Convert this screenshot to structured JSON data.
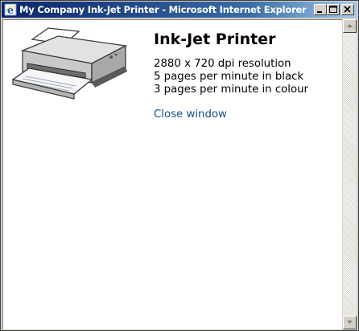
{
  "window": {
    "title": "My Company Ink-Jet Printer - Microsoft Internet Explorer",
    "controls": {
      "minimize_icon": "minimize-icon",
      "maximize_icon": "maximize-icon",
      "close_icon": "close-icon"
    },
    "titlebar_colors": [
      "#0a246a",
      "#a6caf0"
    ]
  },
  "product": {
    "image_icon": "printer-image",
    "name": "Ink-Jet Printer",
    "specs": [
      "2880 x 720 dpi resolution",
      "5 pages per minute in black",
      "3 pages per minute in colour"
    ],
    "close_link": "Close window",
    "link_color": "#1a4b8c"
  },
  "scrollbar": {
    "up_icon": "scroll-up-arrow-icon",
    "down_icon": "scroll-down-arrow-icon"
  }
}
